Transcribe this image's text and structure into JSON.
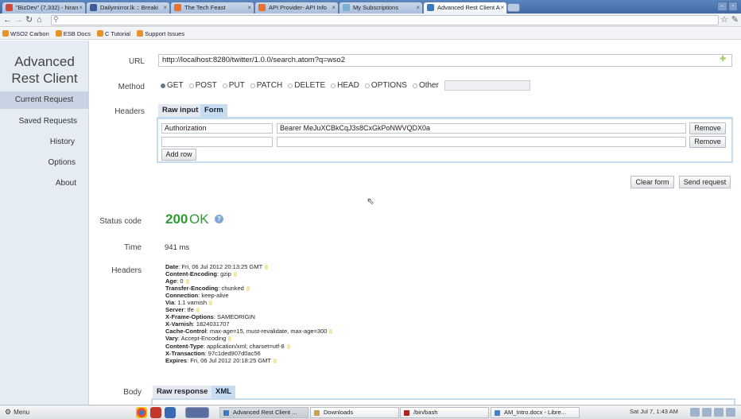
{
  "browser": {
    "tabs": [
      {
        "title": "\"BizDev\" (7,332) - hiran",
        "icon_color": "#d14836",
        "active": false
      },
      {
        "title": "Dailymirror.lk :: Breaki",
        "icon_color": "#3a5a98",
        "active": false
      },
      {
        "title": "The Tech Feast",
        "icon_color": "#e8722c",
        "active": false
      },
      {
        "title": "API Provider- API Info",
        "icon_color": "#e8722c",
        "active": false
      },
      {
        "title": "My Subscriptions",
        "icon_color": "#7ab0d8",
        "active": false
      },
      {
        "title": "Advanced Rest Client A",
        "icon_color": "#3b78c2",
        "active": true
      }
    ],
    "bookmarks": [
      "WSO2 Carbon",
      "ESB Docs",
      "C Tutorial",
      "Support Issues"
    ]
  },
  "sidebar": {
    "title": "Advanced\nRest Client",
    "items": [
      "Current Request",
      "Saved Requests",
      "History",
      "Options",
      "About"
    ]
  },
  "request": {
    "url_label": "URL",
    "url": "http://localhost:8280/twitter/1.0.0/search.atom?q=wso2",
    "method_label": "Method",
    "methods": [
      "GET",
      "POST",
      "PUT",
      "PATCH",
      "DELETE",
      "HEAD",
      "OPTIONS",
      "Other"
    ],
    "selected_method": "GET",
    "headers_label": "Headers",
    "header_tabs": [
      "Raw input",
      "Form"
    ],
    "header_rows": [
      {
        "name": "Authorization",
        "value": "Bearer MeJuXCBkCqJ3s8CxGkPoNWVQDX0a"
      },
      {
        "name": "",
        "value": ""
      }
    ],
    "remove_label": "Remove",
    "add_row_label": "Add row",
    "clear_form_label": "Clear form",
    "send_request_label": "Send request"
  },
  "response": {
    "status_label": "Status code",
    "status_code": "200",
    "status_text": "OK",
    "time_label": "Time",
    "time_value": "941 ms",
    "headers_label": "Headers",
    "headers": [
      {
        "name": "Date",
        "value": "Fri, 06 Jul 2012 20:13:25 GMT",
        "help": true
      },
      {
        "name": "Content-Encoding",
        "value": "gzip",
        "help": true
      },
      {
        "name": "Age",
        "value": "0",
        "help": true
      },
      {
        "name": "Transfer-Encoding",
        "value": "chunked",
        "help": true
      },
      {
        "name": "Connection",
        "value": "keep-alive",
        "help": false
      },
      {
        "name": "Via",
        "value": "1.1 varnish",
        "help": true
      },
      {
        "name": "Server",
        "value": "tfe",
        "help": true
      },
      {
        "name": "X-Frame-Options",
        "value": "SAMEORIGIN",
        "help": false
      },
      {
        "name": "X-Varnish",
        "value": "1824031707",
        "help": false
      },
      {
        "name": "Cache-Control",
        "value": "max-age=15, must-revalidate, max-age=300",
        "help": true
      },
      {
        "name": "Vary",
        "value": "Accept-Encoding",
        "help": true
      },
      {
        "name": "Content-Type",
        "value": "application/xml; charset=utf-8",
        "help": true
      },
      {
        "name": "X-Transaction",
        "value": "97c1ded907d0ac56",
        "help": false
      },
      {
        "name": "Expires",
        "value": "Fri, 06 Jul 2012 20:18:25 GMT",
        "help": true
      }
    ],
    "body_label": "Body",
    "body_tabs": [
      "Raw response",
      "XML"
    ]
  },
  "taskbar": {
    "menu_label": "Menu",
    "tasks": [
      {
        "title": "Advanced Rest Client ...",
        "icon_color": "#3b78c2",
        "active": true
      },
      {
        "title": "Downloads",
        "icon_color": "#c9a34a",
        "active": false
      },
      {
        "title": "/bin/bash",
        "icon_color": "#b22222",
        "active": false
      },
      {
        "title": "AM_Intro.docx - Libre...",
        "icon_color": "#4b7fc3",
        "active": false
      }
    ],
    "clock": "Sat Jul 7,  1:43 AM"
  }
}
